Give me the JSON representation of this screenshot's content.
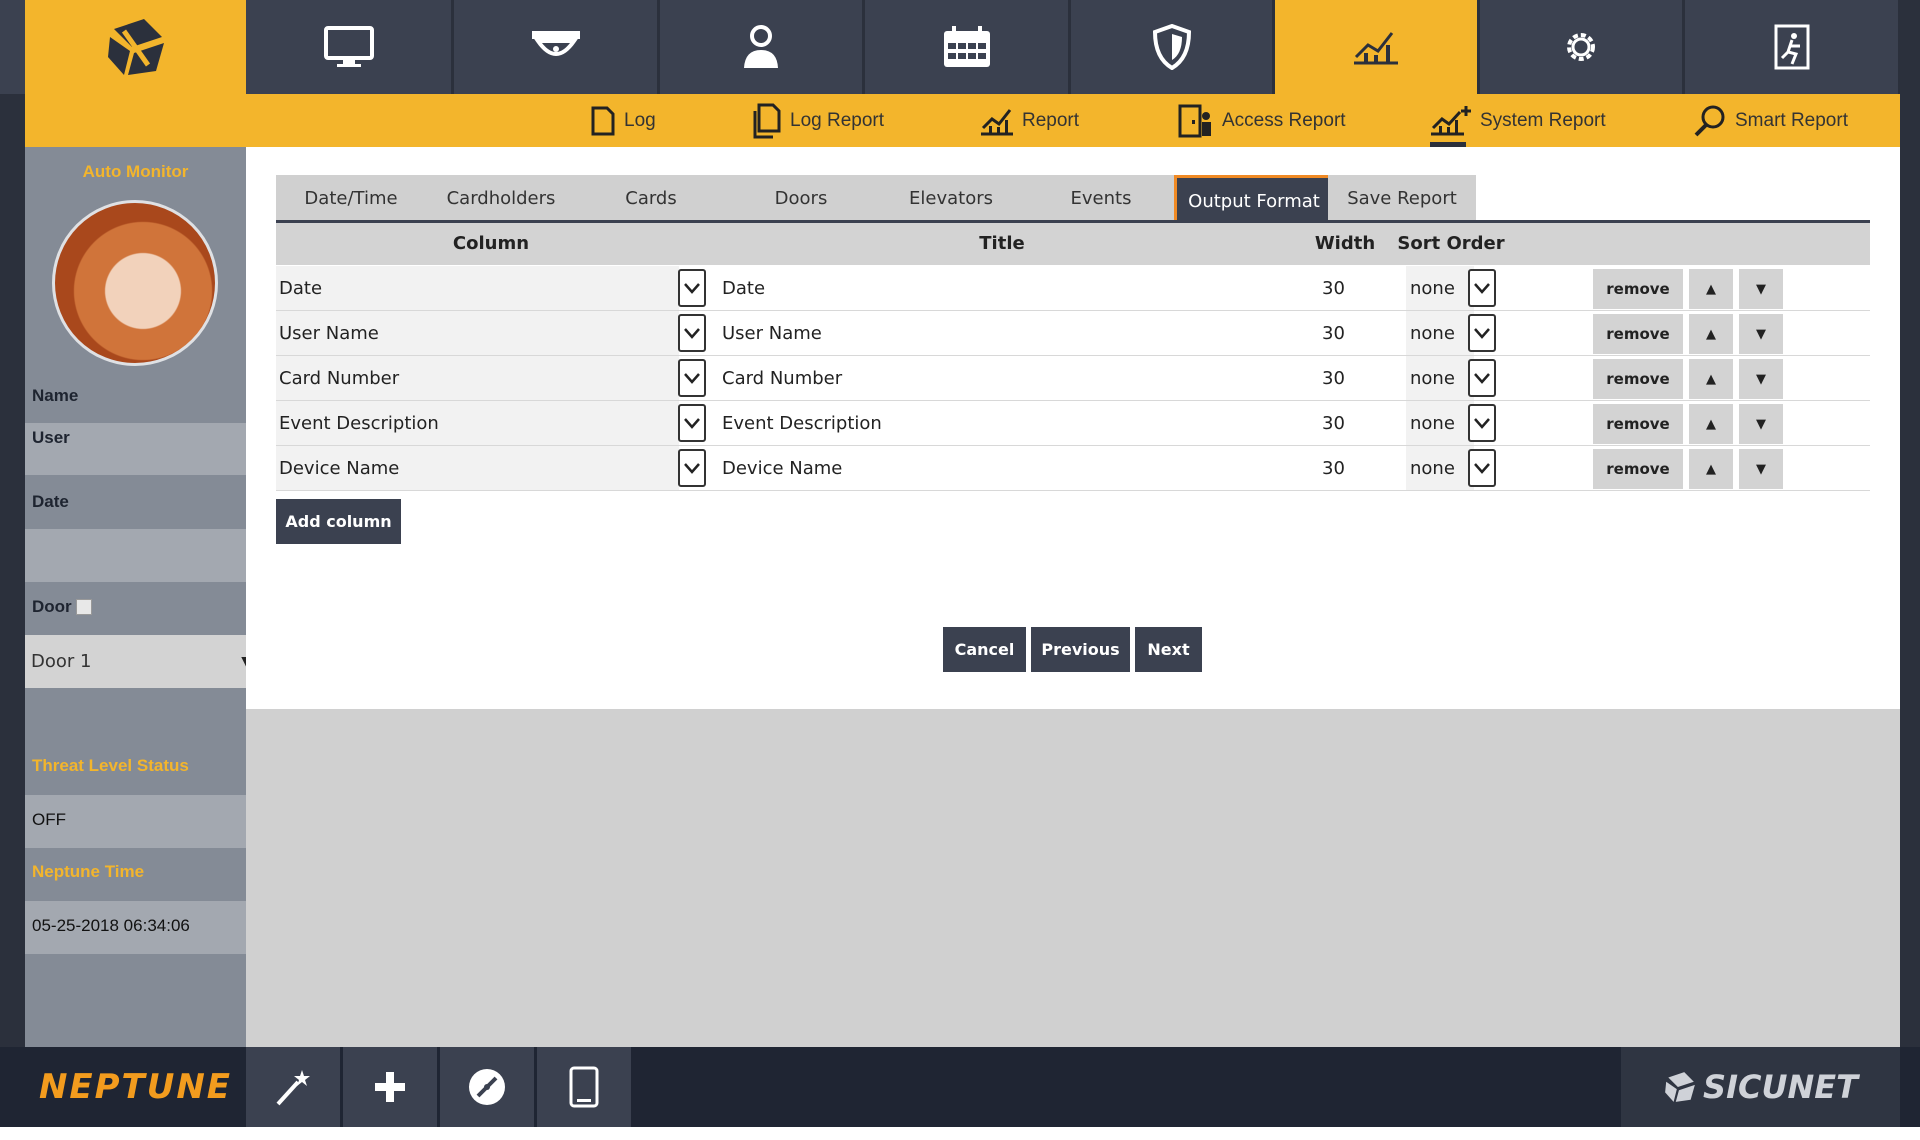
{
  "sub_nav": {
    "items": [
      {
        "label": "Log",
        "icon": "document-icon"
      },
      {
        "label": "Log Report",
        "icon": "documents-icon"
      },
      {
        "label": "Report",
        "icon": "chart-icon"
      },
      {
        "label": "Access Report",
        "icon": "access-icon"
      },
      {
        "label": "System Report",
        "icon": "chart-plus-icon"
      },
      {
        "label": "Smart Report",
        "icon": "search-icon"
      }
    ]
  },
  "sidebar": {
    "title": "Auto Monitor",
    "name_label": "Name",
    "name_value": "User",
    "date_label": "Date",
    "door_label": "Door",
    "door_select": "Door 1",
    "threat_label": "Threat Level Status",
    "threat_value": "OFF",
    "time_label": "Neptune Time",
    "time_value": "05-25-2018 06:34:06"
  },
  "tabs": [
    {
      "label": "Date/Time"
    },
    {
      "label": "Cardholders"
    },
    {
      "label": "Cards"
    },
    {
      "label": "Doors"
    },
    {
      "label": "Elevators"
    },
    {
      "label": "Events"
    },
    {
      "label": "Output Format"
    },
    {
      "label": "Save Report"
    }
  ],
  "table": {
    "headers": {
      "column": "Column",
      "title": "Title",
      "width": "Width",
      "sort": "Sort Order"
    },
    "rows": [
      {
        "column": "Date",
        "title": "Date",
        "width": "30",
        "sort": "none"
      },
      {
        "column": "User Name",
        "title": "User Name",
        "width": "30",
        "sort": "none"
      },
      {
        "column": "Card Number",
        "title": "Card Number",
        "width": "30",
        "sort": "none"
      },
      {
        "column": "Event Description",
        "title": "Event Description",
        "width": "30",
        "sort": "none"
      },
      {
        "column": "Device Name",
        "title": "Device Name",
        "width": "30",
        "sort": "none"
      }
    ],
    "remove_label": "remove",
    "up_label": "▲",
    "down_label": "▼"
  },
  "buttons": {
    "add_column": "Add column",
    "cancel": "Cancel",
    "previous": "Previous",
    "next": "Next"
  },
  "footer": {
    "brand": "NEPTUNE",
    "vendor": "SICUNET"
  },
  "colors": {
    "accent": "#f3b52c",
    "dark": "#3b4150",
    "highlight": "#f08a24"
  }
}
